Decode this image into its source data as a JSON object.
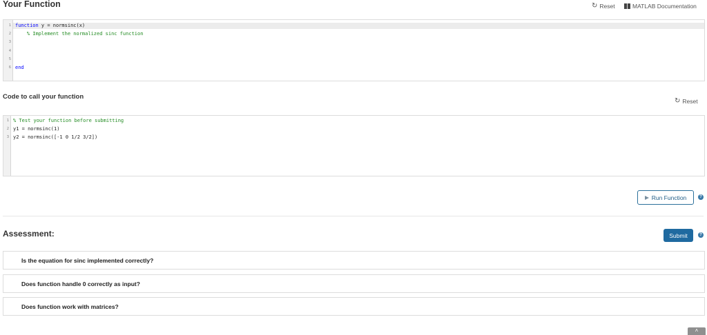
{
  "function_section": {
    "title": "Your Function",
    "reset_label": "Reset",
    "docs_label": "MATLAB Documentation",
    "line_numbers": [
      "1",
      "2",
      "3",
      "4",
      "5",
      "6"
    ],
    "lines": [
      {
        "kw": "function",
        "rest": " y = normsinc(x)"
      },
      {
        "comment": "    % Implement the normalized sinc function"
      },
      {
        "text": ""
      },
      {
        "text": ""
      },
      {
        "text": ""
      },
      {
        "kw": "end",
        "rest": ""
      }
    ]
  },
  "call_section": {
    "title": "Code to call your function",
    "reset_label": "Reset",
    "line_numbers": [
      "1",
      "2",
      "3"
    ],
    "lines": [
      {
        "comment": "% Test your function before submitting"
      },
      {
        "text": "y1 = normsinc(1)"
      },
      {
        "text": "y2 = normsinc([-1 0 1/2 3/2])"
      }
    ]
  },
  "run_button": {
    "label": "Run Function"
  },
  "help_glyph": "?",
  "assessment": {
    "title": "Assessment:",
    "submit_label": "Submit",
    "items": [
      "Is the equation for sinc implemented correctly?",
      "Does function handle 0 correctly as input?",
      "Does function work with matrices?"
    ]
  },
  "colors": {
    "keyword": "#0000ff",
    "comment": "#228b22",
    "submit_bg": "#1f6aa0",
    "run_border": "#2a6f9a"
  },
  "icons": [
    "reset-icon",
    "documentation-icon",
    "play-icon",
    "help-icon",
    "chevron-up-icon"
  ]
}
